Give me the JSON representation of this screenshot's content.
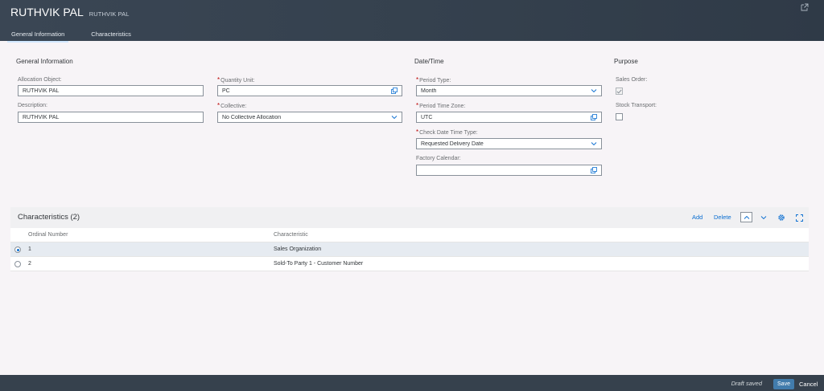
{
  "header": {
    "title": "RUTHVIK PAL",
    "subtitle": "RUTHVIK PAL",
    "export_icon": "export-icon"
  },
  "tabs": [
    {
      "label": "General Information",
      "active": true
    },
    {
      "label": "Characteristics",
      "active": false
    }
  ],
  "general": {
    "section_title": "General Information",
    "allocation_object": {
      "label": "Allocation Object:",
      "value": "RUTHVIK PAL"
    },
    "description": {
      "label": "Description:",
      "value": "RUTHVIK PAL"
    }
  },
  "units": {
    "quantity_unit": {
      "label": "Quantity Unit:",
      "value": "PC",
      "required": true
    },
    "collective": {
      "label": "Collective:",
      "value": "No Collective Allocation",
      "required": true
    }
  },
  "datetime": {
    "section_title": "Date/Time",
    "period_type": {
      "label": "Period Type:",
      "value": "Month",
      "required": true
    },
    "period_time_zone": {
      "label": "Period Time Zone:",
      "value": "UTC",
      "required": true
    },
    "check_date_time_type": {
      "label": "Check Date Time Type:",
      "value": "Requested Delivery Date",
      "required": true
    },
    "factory_calendar": {
      "label": "Factory Calendar:",
      "value": ""
    }
  },
  "purpose": {
    "section_title": "Purpose",
    "sales_order": {
      "label": "Sales Order:",
      "checked": true
    },
    "stock_transport": {
      "label": "Stock Transport:",
      "checked": false
    }
  },
  "characteristics": {
    "title": "Characteristics (2)",
    "toolbar": {
      "add": "Add",
      "delete": "Delete"
    },
    "columns": [
      "Ordinal Number",
      "Characteristic"
    ],
    "rows": [
      {
        "ordinal": "1",
        "characteristic": "Sales Organization",
        "selected": true
      },
      {
        "ordinal": "2",
        "characteristic": "Sold-To Party 1 - Customer Number",
        "selected": false
      }
    ]
  },
  "footer": {
    "status": "Draft saved",
    "save_label": "Save",
    "cancel_label": "Cancel"
  },
  "colors": {
    "header_bg": "#36414d",
    "accent": "#0a6ed1",
    "required": "#bb0000",
    "save_button": "#427cac"
  }
}
